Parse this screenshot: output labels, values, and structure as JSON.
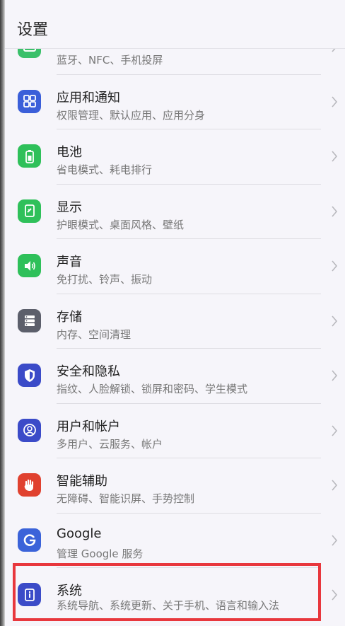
{
  "header": {
    "title": "设置"
  },
  "items": [
    {
      "id": "connect",
      "label": "",
      "desc": "蓝牙、NFC、手机投屏",
      "icon": "device-connection-icon",
      "color": "#3ac06a"
    },
    {
      "id": "apps",
      "label": "应用和通知",
      "desc": "权限管理、默认应用、应用分身",
      "icon": "apps-grid-icon",
      "color": "#3b5fd9"
    },
    {
      "id": "battery",
      "label": "电池",
      "desc": "省电模式、耗电排行",
      "icon": "battery-icon",
      "color": "#2fc05a"
    },
    {
      "id": "display",
      "label": "显示",
      "desc": "护眼模式、桌面风格、壁纸",
      "icon": "display-icon",
      "color": "#2fc05a"
    },
    {
      "id": "sound",
      "label": "声音",
      "desc": "免打扰、铃声、振动",
      "icon": "speaker-icon",
      "color": "#2fc05a"
    },
    {
      "id": "storage",
      "label": "存储",
      "desc": "内存、空间清理",
      "icon": "storage-icon",
      "color": "#5c5f6b"
    },
    {
      "id": "security",
      "label": "安全和隐私",
      "desc": "指纹、人脸解锁、锁屏和密码、学生模式",
      "icon": "shield-icon",
      "color": "#3b4bc8"
    },
    {
      "id": "accounts",
      "label": "用户和帐户",
      "desc": "多用户、云服务、帐户",
      "icon": "user-icon",
      "color": "#3b4bc8"
    },
    {
      "id": "assist",
      "label": "智能辅助",
      "desc": "无障碍、智能识屏、手势控制",
      "icon": "hand-icon",
      "color": "#e0412f"
    },
    {
      "id": "google",
      "label": "Google",
      "desc": "管理 Google 服务",
      "icon": "google-icon",
      "color": "#3b63d9"
    },
    {
      "id": "system",
      "label": "系统",
      "desc": "系统导航、系统更新、关于手机、语言和输入法",
      "icon": "system-info-icon",
      "color": "#3b4bc8"
    }
  ]
}
